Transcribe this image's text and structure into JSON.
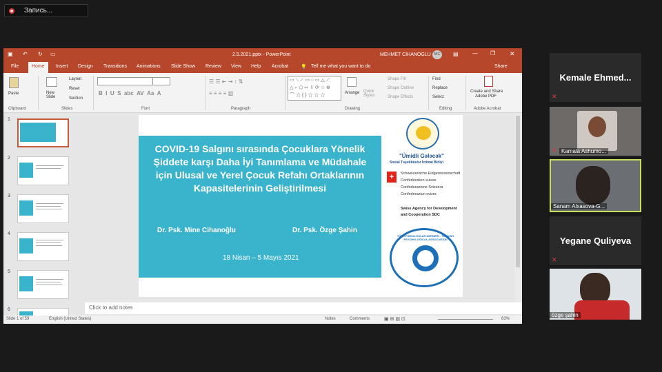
{
  "recording": {
    "label": "Запись..."
  },
  "ppt": {
    "filename": "2.5.2021.pptx",
    "app": "PowerPoint",
    "user": "MEHMET CIHANOGLU",
    "initials": "MC",
    "tabs": [
      "File",
      "Home",
      "Insert",
      "Design",
      "Transitions",
      "Animations",
      "Slide Show",
      "Review",
      "View",
      "Help",
      "Acrobat"
    ],
    "tellme": "Tell me what you want to do",
    "share": "Share",
    "ribbon": {
      "paste": "Paste",
      "new_slide": "New Slide",
      "layout": "Layout",
      "reset": "Reset",
      "section": "Section",
      "arrange": "Arrange",
      "quick_styles": "Quick Styles",
      "shape_fill": "Shape Fill",
      "shape_outline": "Shape Outline",
      "shape_effects": "Shape Effects",
      "find": "Find",
      "replace": "Replace",
      "select": "Select",
      "create_share": "Create and Share",
      "adobe_pdf": "Adobe PDF",
      "groups": {
        "clipboard": "Clipboard",
        "slides": "Slides",
        "font": "Font",
        "paragraph": "Paragraph",
        "drawing": "Drawing",
        "editing": "Editing",
        "adobe": "Adobe Acrobat"
      }
    },
    "thumb_numbers": [
      "1",
      "2",
      "3",
      "4",
      "5",
      "6"
    ],
    "slide": {
      "title": "COVID-19 Salgını sırasında Çocuklara Yönelik Şiddete karşı Daha İyi Tanımlama ve Müdahale için Ulusal ve Yerel Çocuk Refahı Ortaklarının Kapasitelerinin Geliştirilmesi",
      "author1": "Dr. Psk. Mine Cihanoğlu",
      "author2": "Dr. Psk. Özge Şahin",
      "date": "18 Nisan – 5 Mayıs 2021",
      "logo1_name": "\"Ümidli Gələcək\"",
      "logo1_sub": "Sosial Təşəbbüslər İctimai Birliyi",
      "swiss_lines": [
        "Schweizerische Eidgenossenschaft",
        "Confédération suisse",
        "Confederazione Svizzera",
        "Confederaziun svizra"
      ],
      "swiss_agency": "Swiss Agency for Development and Cooperation SDC",
      "tpd_text": "TÜRK PSİKOLOGLAR DERNEĞİ · TURKISH PSYCHOLOGICAL ASSOCIATION"
    },
    "notes_placeholder": "Click to add notes",
    "status": {
      "slide": "Slide 1 of 59",
      "language": "English (United States)",
      "notes": "Notes",
      "comments": "Comments",
      "zoom": "63%"
    }
  },
  "participants": [
    {
      "name": "Kemale  Ehmed...",
      "type": "name"
    },
    {
      "name": "Kamala Ashumo...",
      "type": "video"
    },
    {
      "name": "Sanam Alxasova-G...",
      "type": "video"
    },
    {
      "name": "Yegane  Quliyeva",
      "type": "name"
    },
    {
      "name": "özge şahin",
      "type": "video"
    }
  ]
}
